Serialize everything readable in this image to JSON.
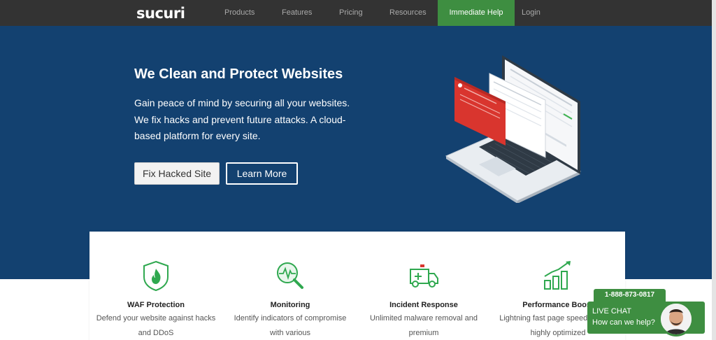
{
  "nav": {
    "logo": "sucuri",
    "items": [
      {
        "label": "Products"
      },
      {
        "label": "Features"
      },
      {
        "label": "Pricing"
      },
      {
        "label": "Resources"
      }
    ],
    "help": "Immediate Help",
    "login": "Login"
  },
  "hero": {
    "title": "We Clean and Protect Websites",
    "subtitle": "Gain peace of mind by securing all your websites. We fix hacks and prevent future attacks. A cloud-based platform for every site.",
    "btn_fix": "Fix Hacked Site",
    "btn_learn": "Learn More"
  },
  "features": [
    {
      "title": "WAF Protection",
      "desc": "Defend your website against hacks and DDoS",
      "icon": "shield-flame-icon"
    },
    {
      "title": "Monitoring",
      "desc": "Identify indicators of compromise with various",
      "icon": "magnifier-pulse-icon"
    },
    {
      "title": "Incident Response",
      "desc": "Unlimited malware removal and premium",
      "icon": "ambulance-icon"
    },
    {
      "title": "Performance Boost",
      "desc": "Lightning fast page speed with our highly optimized",
      "icon": "growth-chart-icon"
    }
  ],
  "chat": {
    "phone": "1-888-873-0817",
    "title": "LIVE CHAT",
    "subtitle": "How can we help?"
  },
  "colors": {
    "nav_bg": "#333333",
    "hero_bg": "#134170",
    "accent_green": "#3e8e41",
    "icon_green": "#2fa84f"
  }
}
